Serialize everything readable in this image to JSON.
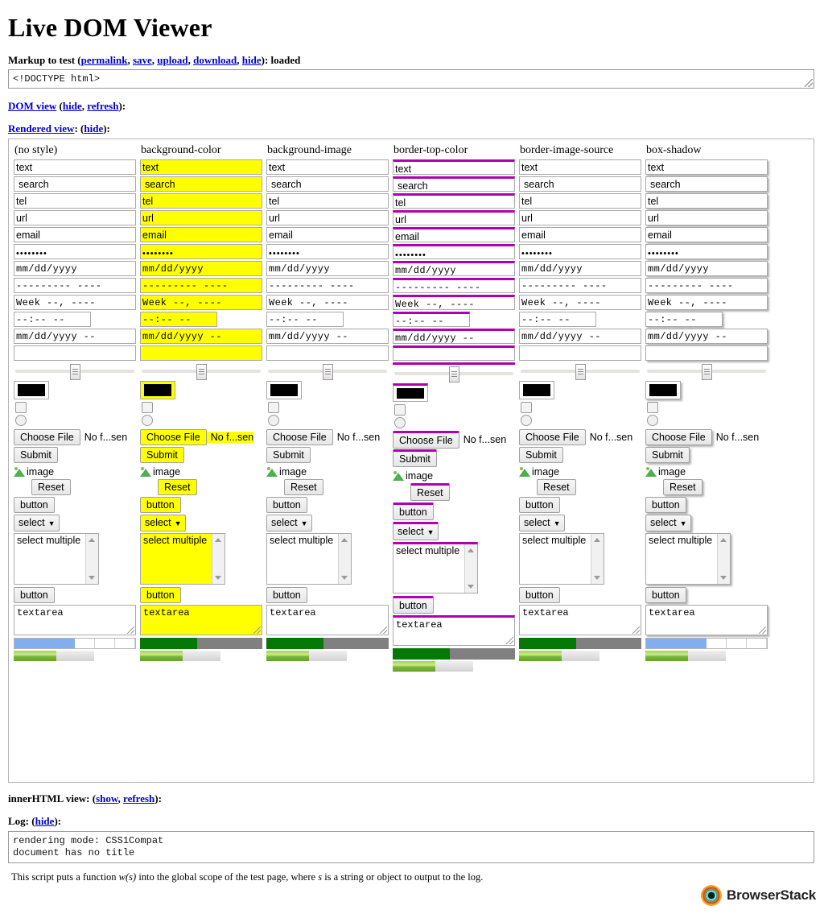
{
  "page_title": "Live DOM Viewer",
  "markup": {
    "label_prefix": "Markup to test (",
    "links": [
      "permalink",
      "save",
      "upload",
      "download",
      "hide"
    ],
    "label_suffix": "): loaded",
    "value": "<!DOCTYPE html>"
  },
  "dom_view": {
    "label": "DOM view",
    "links": [
      "hide",
      "refresh"
    ]
  },
  "rendered_view": {
    "label": "Rendered view",
    "links": [
      "hide"
    ]
  },
  "innerhtml_view": {
    "label": "innerHTML view:",
    "links": [
      "show",
      "refresh"
    ]
  },
  "log": {
    "label": "Log:",
    "links": [
      "hide"
    ],
    "lines": [
      "rendering mode: CSS1Compat",
      "document has no title"
    ]
  },
  "footnote": {
    "part1": "This script puts a function ",
    "code": "w(s)",
    "part2": " into the global scope of the test page, where ",
    "var": "s",
    "part3": " is a string or object to output to the log."
  },
  "branding": {
    "name": "BrowserStack"
  },
  "colors": {
    "highlight_yellow": "#ffff00",
    "border_magenta": "#b000b0",
    "progress_blue": "#81aef0",
    "progress_green": "#067806",
    "progress_track_gray": "#808080",
    "link_blue": "#0000cc"
  },
  "columns": [
    {
      "title": "(no style)",
      "style_class": "c-none"
    },
    {
      "title": "background-color",
      "style_class": "c-bg"
    },
    {
      "title": "background-image",
      "style_class": "c-bi"
    },
    {
      "title": "border-top-color",
      "style_class": "c-btc"
    },
    {
      "title": "border-image-source",
      "style_class": "c-bis"
    },
    {
      "title": "box-shadow",
      "style_class": "c-bs"
    }
  ],
  "widgets": {
    "text": "text",
    "search": "search",
    "tel": "tel",
    "url": "url",
    "email": "email",
    "password": "••••••••",
    "date": "mm/dd/yyyy",
    "month": "--------- ----",
    "week": "Week --, ----",
    "time": "--:-- --",
    "datetime_local": "mm/dd/yyyy --",
    "color": "",
    "file_button": "Choose File",
    "file_status": "No f...sen",
    "submit": "Submit",
    "image_alt": "image",
    "reset": "Reset",
    "button": "button",
    "select": "select",
    "select_arrow": "▼",
    "select_multiple": "select multiple",
    "button2": "button",
    "textarea": "textarea"
  },
  "chart_values": {
    "range_position_percent": 48,
    "progress_percent": 50,
    "meter_percent": 53
  }
}
